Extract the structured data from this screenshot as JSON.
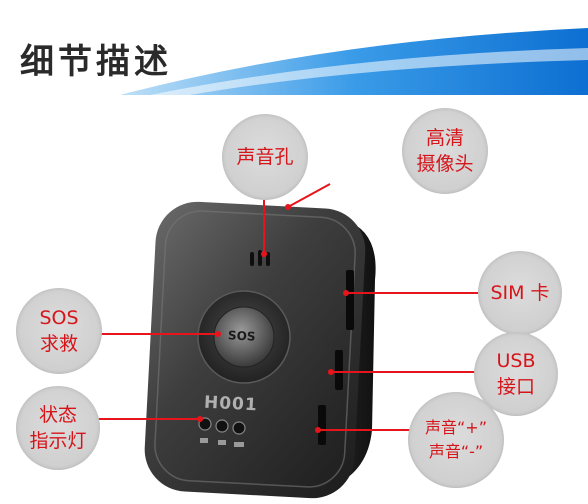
{
  "header": {
    "title": "细节描述"
  },
  "device": {
    "model": "H001",
    "sos_button": "SOS"
  },
  "callouts": {
    "speaker": "声音孔",
    "camera": [
      "高清",
      "摄像头"
    ],
    "sim": "SIM 卡",
    "sos": [
      "SOS",
      "求救"
    ],
    "usb": [
      "USB",
      "接口"
    ],
    "status": [
      "状态",
      "指示灯"
    ],
    "volume": [
      "声音“+”",
      "声音“-”"
    ]
  },
  "colors": {
    "label_red": "#d6151b",
    "line_red": "#e8141b",
    "header_blue": "#1e88e5"
  }
}
